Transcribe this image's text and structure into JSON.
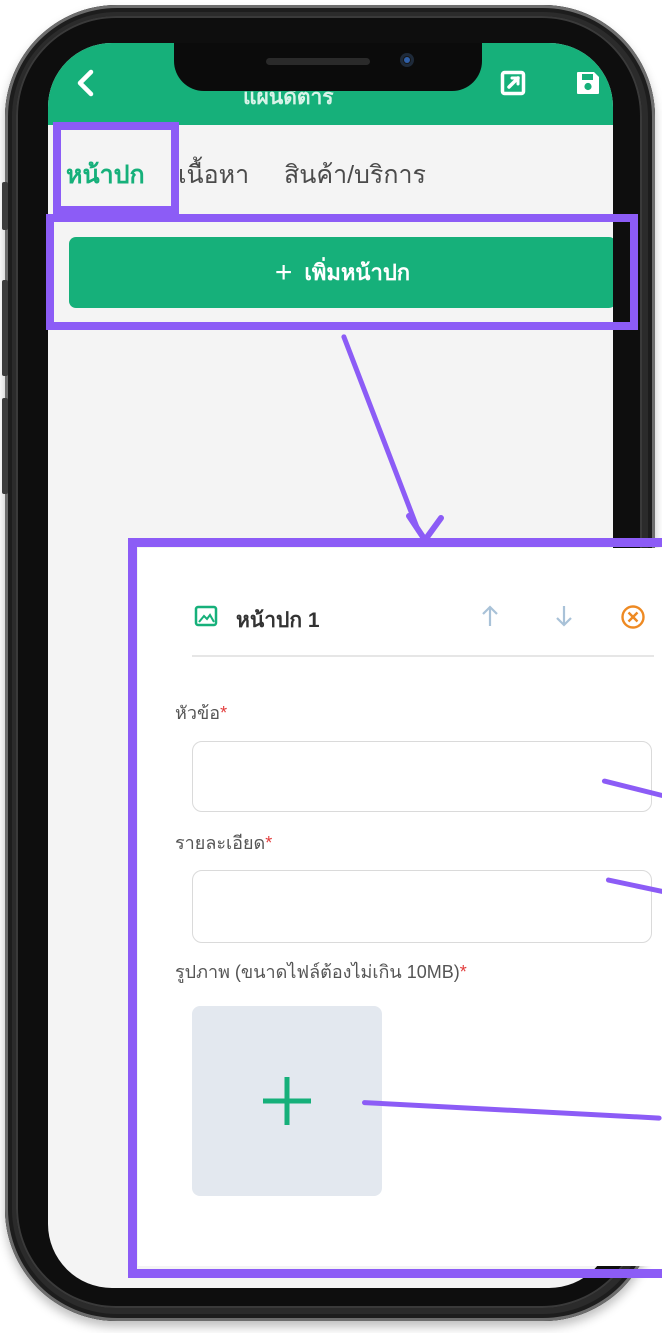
{
  "app": {
    "title": "แผนดิตาร",
    "icons": {
      "back": "chevron-left-icon",
      "open": "external-edit-icon",
      "save": "save-icon"
    }
  },
  "tabs": [
    {
      "label": "หน้าปก",
      "active": true
    },
    {
      "label": "เนื้อหา",
      "active": false
    },
    {
      "label": "สินค้า/บริการ",
      "active": false
    }
  ],
  "add_cover_button": {
    "icon": "+",
    "label": "เพิ่มหน้าปก"
  },
  "cover_card": {
    "title": "หน้าปก 1",
    "icons": {
      "cover": "image-icon",
      "move_up": "arrow-up-icon",
      "move_down": "arrow-down-icon",
      "remove": "close-circle-icon"
    },
    "fields": {
      "heading": {
        "label": "หัวข้อ",
        "required_mark": "*",
        "value": ""
      },
      "detail": {
        "label": "รายละเอียด",
        "required_mark": "*",
        "value": ""
      },
      "image": {
        "label": "รูปภาพ (ขนาดไฟล์ต้องไม่เกิน 10MB)",
        "required_mark": "*",
        "upload_symbol": "+"
      }
    }
  },
  "colors": {
    "brand_green": "#16b07a",
    "highlight_purple": "#8c5cf6",
    "required_red": "#e23b3b",
    "remove_orange": "#ee8a23"
  }
}
